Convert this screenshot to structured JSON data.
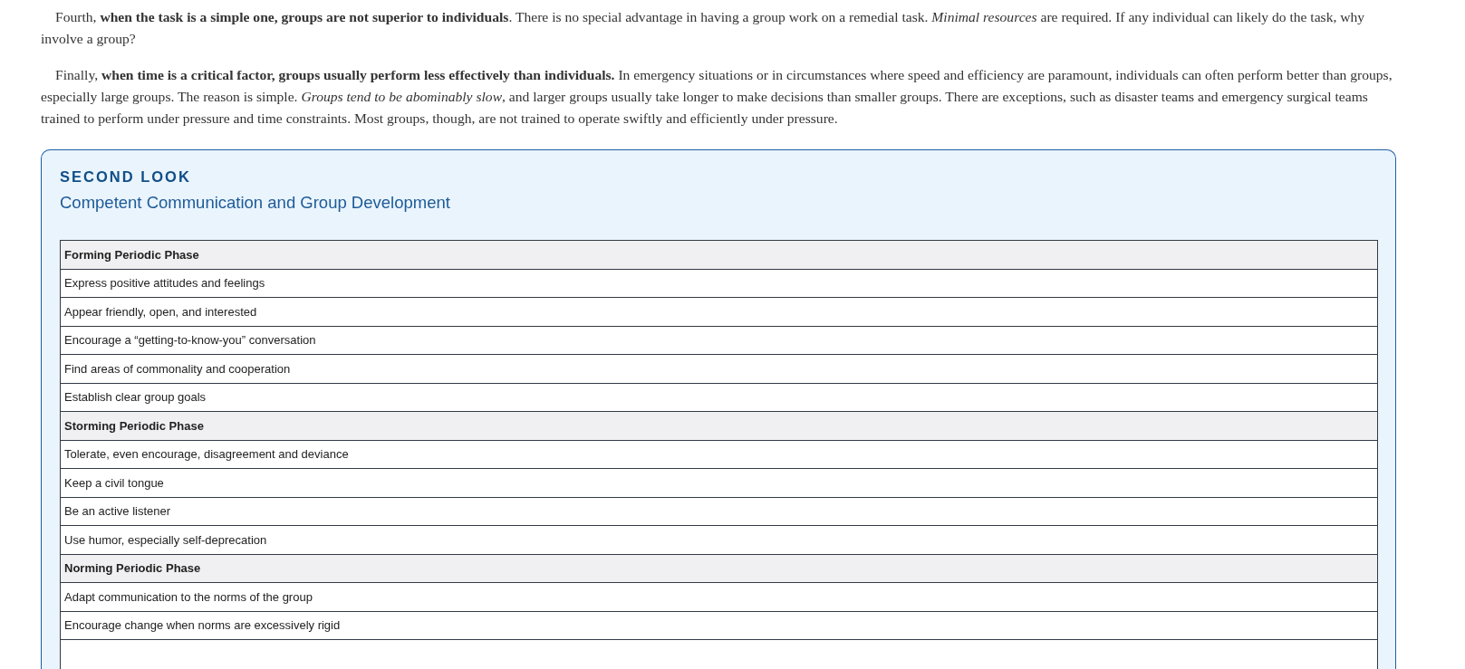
{
  "paragraphs": [
    "Fourth, **when the task is a simple one, groups are not superior to individuals**. There is no special advantage in having a group work on a remedial task. *Minimal resources* are required. If any individual can likely do the task, why involve a group?",
    "Finally, **when time is a critical factor, groups usually perform less effectively than individuals.** In emergency situations or in circumstances where speed and efficiency are paramount, individuals can often perform better than groups, especially large groups. The reason is simple. *Groups tend to be abominably slow*, and larger groups usually take longer to make decisions than smaller groups. There are exceptions, such as disaster teams and emergency surgical teams trained to perform under pressure and time constraints. Most groups, though, are not trained to operate swiftly and efficiently under pressure."
  ],
  "box": {
    "label": "SECOND LOOK",
    "title": "Competent Communication and Group Development",
    "rows": [
      {
        "kind": "header",
        "text": "Forming Periodic Phase"
      },
      {
        "kind": "item",
        "text": "Express positive attitudes and feelings"
      },
      {
        "kind": "item",
        "text": "Appear friendly, open, and interested"
      },
      {
        "kind": "item",
        "text": "Encourage a “getting-to-know-you” conversation"
      },
      {
        "kind": "item",
        "text": "Find areas of commonality and cooperation"
      },
      {
        "kind": "item",
        "text": "Establish clear group goals"
      },
      {
        "kind": "header",
        "text": "Storming Periodic Phase"
      },
      {
        "kind": "item",
        "text": "Tolerate, even encourage, disagreement and deviance"
      },
      {
        "kind": "item",
        "text": "Keep a civil tongue"
      },
      {
        "kind": "item",
        "text": "Be an active listener"
      },
      {
        "kind": "item",
        "text": "Use humor, especially self-deprecation"
      },
      {
        "kind": "header",
        "text": "Norming Periodic Phase"
      },
      {
        "kind": "item",
        "text": "Adapt communication to the norms of the group"
      },
      {
        "kind": "item",
        "text": "Encourage change when norms are excessively rigid"
      }
    ]
  }
}
